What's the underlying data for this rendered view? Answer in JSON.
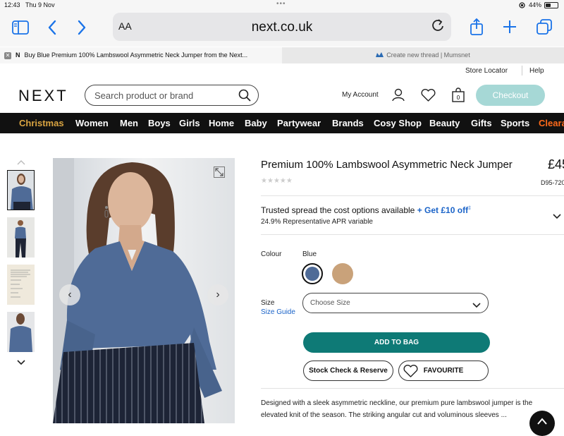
{
  "status_bar": {
    "time": "12:43",
    "date": "Thu 9 Nov",
    "battery": "44%"
  },
  "browser": {
    "aa_label": "AA",
    "url": "next.co.uk",
    "tabs": [
      {
        "label": "Buy Blue Premium 100% Lambswool Asymmetric Neck Jumper from the Next...",
        "icon": "N",
        "close": "✕"
      },
      {
        "label": "Create new thread | Mumsnet",
        "icon": "mumsnet-icon"
      }
    ]
  },
  "utility": {
    "store_locator": "Store Locator",
    "help": "Help"
  },
  "header": {
    "logo": "NEXT",
    "search_placeholder": "Search product or brand",
    "my_account": "My Account",
    "checkout": "Checkout"
  },
  "nav": {
    "items": [
      "Christmas",
      "Women",
      "Men",
      "Boys",
      "Girls",
      "Home",
      "Baby",
      "Partywear",
      "Brands",
      "Cosy Shop",
      "Beauty",
      "Gifts",
      "Sports",
      "Clearance"
    ]
  },
  "colors": {
    "accent_green": "#0e7a76",
    "christmas": "#d9a441",
    "clearance": "#ff6a1a",
    "link_blue": "#1a63c8"
  },
  "product": {
    "title": "Premium 100% Lambswool Asymmetric Neck Jumper",
    "price": "£45",
    "rating": "0 of 5 stars",
    "code": "D95-720",
    "finance_text": "Trusted spread the cost options available",
    "finance_link": "+ Get £10 off",
    "finance_marker": "‡",
    "apr": "24.9% Representative APR variable",
    "colour_label": "Colour",
    "colour_value": "Blue",
    "swatches": [
      {
        "name": "Blue",
        "color": "#4f6b97",
        "selected": true
      },
      {
        "name": "Camel",
        "color": "#c9a27a",
        "selected": false
      }
    ],
    "size_label": "Size",
    "size_guide": "Size Guide",
    "size_placeholder": "Choose Size",
    "add_to_bag": "ADD TO BAG",
    "stock_check": "Stock Check & Reserve",
    "favourite": "FAVOURITE",
    "description_line1": "Designed with a sleek asymmetric neckline, our premium pure lambswool jumper is the",
    "description_line2": "elevated knit of the season. The striking angular cut and voluminous sleeves ..."
  }
}
